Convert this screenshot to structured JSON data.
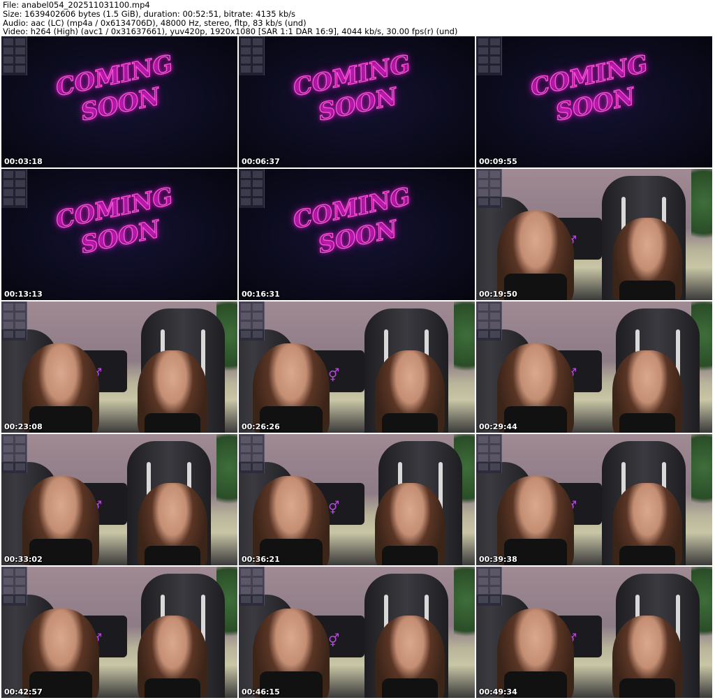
{
  "header": {
    "line1": "File: anabel054_202511031100.mp4",
    "line2": "Size: 1639402606 bytes (1.5 GiB), duration: 00:52:51, bitrate: 4135 kb/s",
    "line3": "Audio: aac (LC) (mp4a / 0x6134706D), 48000 Hz, stereo, fltp, 83 kb/s (und)",
    "line4": "Video: h264 (High) (avc1 / 0x31637661), yuv420p, 1920x1080 [SAR 1:1 DAR 16:9], 4044 kb/s, 30.00 fps(r) (und)"
  },
  "neon_text": {
    "line1": "COMING",
    "line2": "SOON"
  },
  "thumbnails": [
    {
      "timestamp": "00:03:18",
      "scene": "coming-soon"
    },
    {
      "timestamp": "00:06:37",
      "scene": "coming-soon"
    },
    {
      "timestamp": "00:09:55",
      "scene": "coming-soon"
    },
    {
      "timestamp": "00:13:13",
      "scene": "coming-soon"
    },
    {
      "timestamp": "00:16:31",
      "scene": "coming-soon"
    },
    {
      "timestamp": "00:19:50",
      "scene": "room"
    },
    {
      "timestamp": "00:23:08",
      "scene": "room"
    },
    {
      "timestamp": "00:26:26",
      "scene": "room"
    },
    {
      "timestamp": "00:29:44",
      "scene": "room"
    },
    {
      "timestamp": "00:33:02",
      "scene": "room"
    },
    {
      "timestamp": "00:36:21",
      "scene": "room"
    },
    {
      "timestamp": "00:39:38",
      "scene": "room"
    },
    {
      "timestamp": "00:42:57",
      "scene": "room"
    },
    {
      "timestamp": "00:46:15",
      "scene": "room"
    },
    {
      "timestamp": "00:49:34",
      "scene": "room"
    }
  ],
  "colors": {
    "neon_pink": "#ff4fd8",
    "background_dark": "#0b0a1c",
    "wall": "#8d7b86",
    "sofa": "#c9c6a6",
    "chair": "#2a2a30"
  }
}
